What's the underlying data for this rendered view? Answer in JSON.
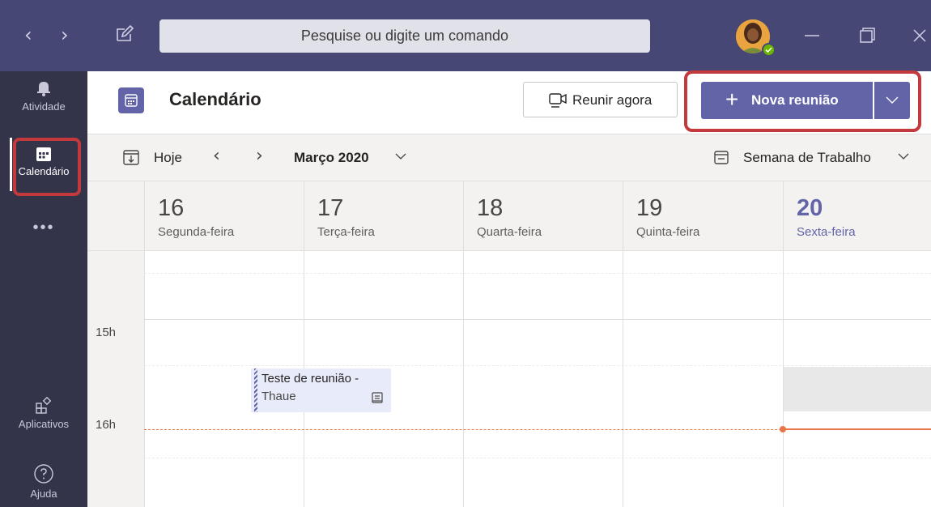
{
  "titlebar": {
    "search_placeholder": "Pesquise ou digite um comando",
    "back_glyph": "‹",
    "forward_glyph": "›"
  },
  "rail": {
    "items": [
      {
        "label": "Atividade",
        "icon": "bell-icon"
      },
      {
        "label": "Calendário",
        "icon": "calendar-icon",
        "active": true
      },
      {
        "label": "•••",
        "icon": "more-icon"
      },
      {
        "label": "Aplicativos",
        "icon": "apps-icon"
      },
      {
        "label": "Ajuda",
        "icon": "help-icon"
      }
    ]
  },
  "header": {
    "title": "Calendário",
    "meet_now_label": "Reunir agora",
    "new_meeting_label": "Nova reunião",
    "new_meeting_plus": "+"
  },
  "toolbar": {
    "today_label": "Hoje",
    "prev_glyph": "‹",
    "next_glyph": "›",
    "month_label": "Março 2020",
    "view_label": "Semana de Trabalho"
  },
  "days": [
    {
      "num": "16",
      "name": "Segunda-feira",
      "today": false
    },
    {
      "num": "17",
      "name": "Terça-feira",
      "today": false
    },
    {
      "num": "18",
      "name": "Quarta-feira",
      "today": false
    },
    {
      "num": "19",
      "name": "Quinta-feira",
      "today": false
    },
    {
      "num": "20",
      "name": "Sexta-feira",
      "today": true
    }
  ],
  "hours": [
    "15h",
    "16h"
  ],
  "event": {
    "title": "Teste de reunião -",
    "organizer": "Thaue"
  },
  "colors": {
    "brand": "#6264a7",
    "titlebar": "#464775",
    "rail": "#33344a",
    "highlight": "#c4393b",
    "now_line": "#e97548"
  }
}
